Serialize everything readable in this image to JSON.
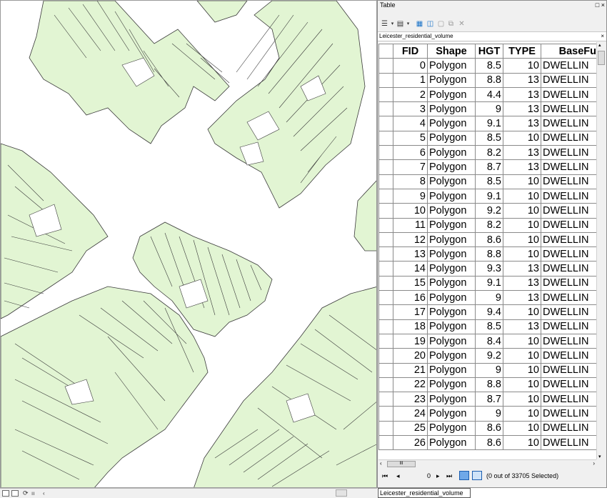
{
  "table_window": {
    "title": "Table",
    "title_buttons": "□ ×",
    "layer_tab": "Leicester_residential_volume",
    "tab_close": "×",
    "columns": [
      "FID",
      "Shape",
      "HGT",
      "TYPE",
      "BaseFu"
    ],
    "rows": [
      [
        "0",
        "Polygon",
        "8.5",
        "10",
        "DWELLIN"
      ],
      [
        "1",
        "Polygon",
        "8.8",
        "13",
        "DWELLIN"
      ],
      [
        "2",
        "Polygon",
        "4.4",
        "13",
        "DWELLIN"
      ],
      [
        "3",
        "Polygon",
        "9",
        "13",
        "DWELLIN"
      ],
      [
        "4",
        "Polygon",
        "9.1",
        "13",
        "DWELLIN"
      ],
      [
        "5",
        "Polygon",
        "8.5",
        "10",
        "DWELLIN"
      ],
      [
        "6",
        "Polygon",
        "8.2",
        "13",
        "DWELLIN"
      ],
      [
        "7",
        "Polygon",
        "8.7",
        "13",
        "DWELLIN"
      ],
      [
        "8",
        "Polygon",
        "8.5",
        "10",
        "DWELLIN"
      ],
      [
        "9",
        "Polygon",
        "9.1",
        "10",
        "DWELLIN"
      ],
      [
        "10",
        "Polygon",
        "9.2",
        "10",
        "DWELLIN"
      ],
      [
        "11",
        "Polygon",
        "8.2",
        "10",
        "DWELLIN"
      ],
      [
        "12",
        "Polygon",
        "8.6",
        "10",
        "DWELLIN"
      ],
      [
        "13",
        "Polygon",
        "8.8",
        "10",
        "DWELLIN"
      ],
      [
        "14",
        "Polygon",
        "9.3",
        "13",
        "DWELLIN"
      ],
      [
        "15",
        "Polygon",
        "9.1",
        "13",
        "DWELLIN"
      ],
      [
        "16",
        "Polygon",
        "9",
        "13",
        "DWELLIN"
      ],
      [
        "17",
        "Polygon",
        "9.4",
        "10",
        "DWELLIN"
      ],
      [
        "18",
        "Polygon",
        "8.5",
        "13",
        "DWELLIN"
      ],
      [
        "19",
        "Polygon",
        "8.4",
        "10",
        "DWELLIN"
      ],
      [
        "20",
        "Polygon",
        "9.2",
        "10",
        "DWELLIN"
      ],
      [
        "21",
        "Polygon",
        "9",
        "10",
        "DWELLIN"
      ],
      [
        "22",
        "Polygon",
        "8.8",
        "10",
        "DWELLIN"
      ],
      [
        "23",
        "Polygon",
        "8.7",
        "10",
        "DWELLIN"
      ],
      [
        "24",
        "Polygon",
        "9",
        "10",
        "DWELLIN"
      ],
      [
        "25",
        "Polygon",
        "8.6",
        "10",
        "DWELLIN"
      ],
      [
        "26",
        "Polygon",
        "8.6",
        "10",
        "DWELLIN"
      ]
    ],
    "navigation": {
      "current_record": "0",
      "selection_status": "(0 out of 33705 Selected)"
    },
    "bottom_tab": "Leicester_residential_volume",
    "hscroll_thumb": "III"
  },
  "map": {
    "polygon_fill": "#e2f5d3",
    "polygon_stroke": "#3a3a3a"
  },
  "icons": {
    "table_options": "table-options-icon",
    "related_tables": "related-tables-icon",
    "select_by_attributes": "select-by-attributes-icon",
    "switch_selection": "switch-selection-icon",
    "clear_selection": "clear-selection-icon",
    "zoom_to_selected": "zoom-to-selected-icon",
    "delete_selected": "delete-selected-icon"
  }
}
